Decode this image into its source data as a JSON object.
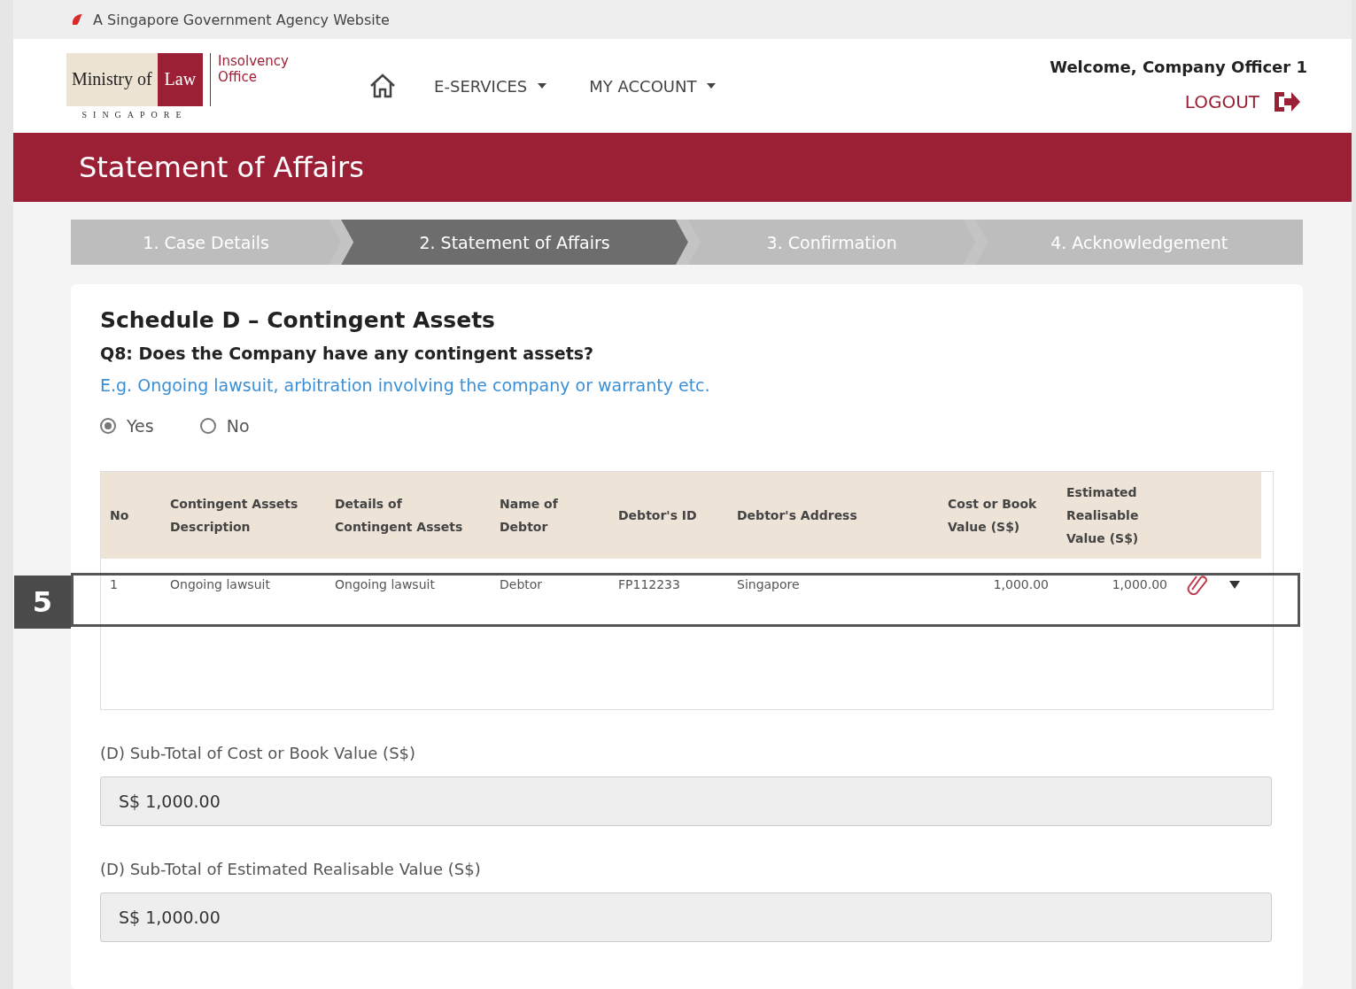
{
  "masthead": {
    "text": "A Singapore Government Agency Website"
  },
  "header": {
    "logo": {
      "ministry": "Ministry of",
      "law": "Law",
      "country": "SINGAPORE",
      "office": "Insolvency Office"
    },
    "nav": [
      {
        "label": "E-SERVICES"
      },
      {
        "label": "MY ACCOUNT"
      }
    ],
    "welcome": "Welcome, Company Officer 1",
    "logout": "LOGOUT"
  },
  "banner": {
    "title": "Statement of Affairs"
  },
  "steps": [
    {
      "label": "1. Case Details",
      "selected": false
    },
    {
      "label": "2. Statement of Affairs",
      "selected": true
    },
    {
      "label": "3. Confirmation",
      "selected": false
    },
    {
      "label": "4. Acknowledgement",
      "selected": false
    }
  ],
  "section": {
    "title": "Schedule D – Contingent Assets",
    "question": "Q8: Does the Company have any contingent assets?",
    "hint": "E.g. Ongoing lawsuit, arbitration involving the company or warranty etc.",
    "options": [
      {
        "label": "Yes",
        "selected": true
      },
      {
        "label": "No",
        "selected": false
      }
    ]
  },
  "table": {
    "columns": [
      "No",
      "Contingent Assets Description",
      "Details of Contingent Assets",
      "Name of Debtor",
      "Debtor's ID",
      "Debtor's Address",
      "Cost or Book Value (S$)",
      "Estimated Realisable Value (S$)"
    ],
    "rows": [
      {
        "cells": [
          "1",
          "Ongoing lawsuit",
          "Ongoing lawsuit",
          "Debtor",
          "FP112233",
          "Singapore",
          "1,000.00",
          "1,000.00"
        ]
      }
    ]
  },
  "callout": {
    "number": "5"
  },
  "totals": [
    {
      "label": "(D) Sub-Total of Cost or Book Value (S$)",
      "value": "S$ 1,000.00"
    },
    {
      "label": "(D) Sub-Total of Estimated Realisable Value (S$)",
      "value": "S$ 1,000.00"
    }
  ]
}
